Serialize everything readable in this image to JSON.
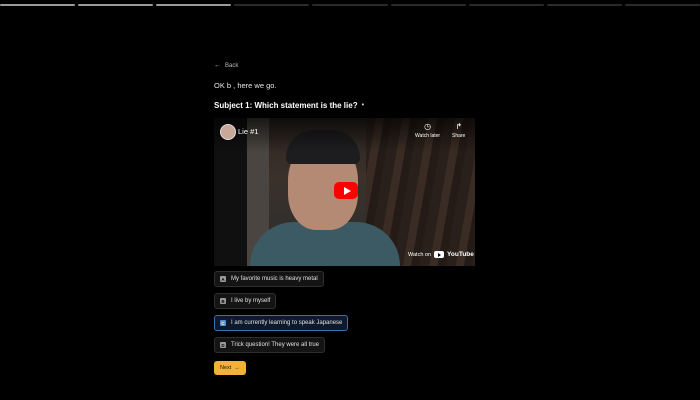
{
  "back": {
    "label": "Back"
  },
  "greeting": "OK b , here we go.",
  "question": {
    "text": "Subject 1: Which statement is the lie?",
    "marker": "•"
  },
  "video": {
    "title": "Lie #1",
    "watch_later": "Watch later",
    "share": "Share",
    "watch_on": "Watch on",
    "brand": "YouTube"
  },
  "options": [
    {
      "key": "A",
      "label": "My favorite music is heavy metal",
      "selected": false
    },
    {
      "key": "B",
      "label": "I live by myself",
      "selected": false
    },
    {
      "key": "C",
      "label": "I am currently learning to speak Japanese",
      "selected": true
    },
    {
      "key": "D",
      "label": "Trick question! They were all true",
      "selected": false
    }
  ],
  "next": {
    "label": "Next",
    "arrow": "→"
  },
  "colors": {
    "accent": "#f2b23a",
    "selected_border": "#3a6fb3",
    "youtube_red": "#ff0000"
  },
  "icons": {
    "back": "arrow-left-icon",
    "watch_later": "clock-icon",
    "share": "share-icon",
    "play": "play-icon"
  }
}
